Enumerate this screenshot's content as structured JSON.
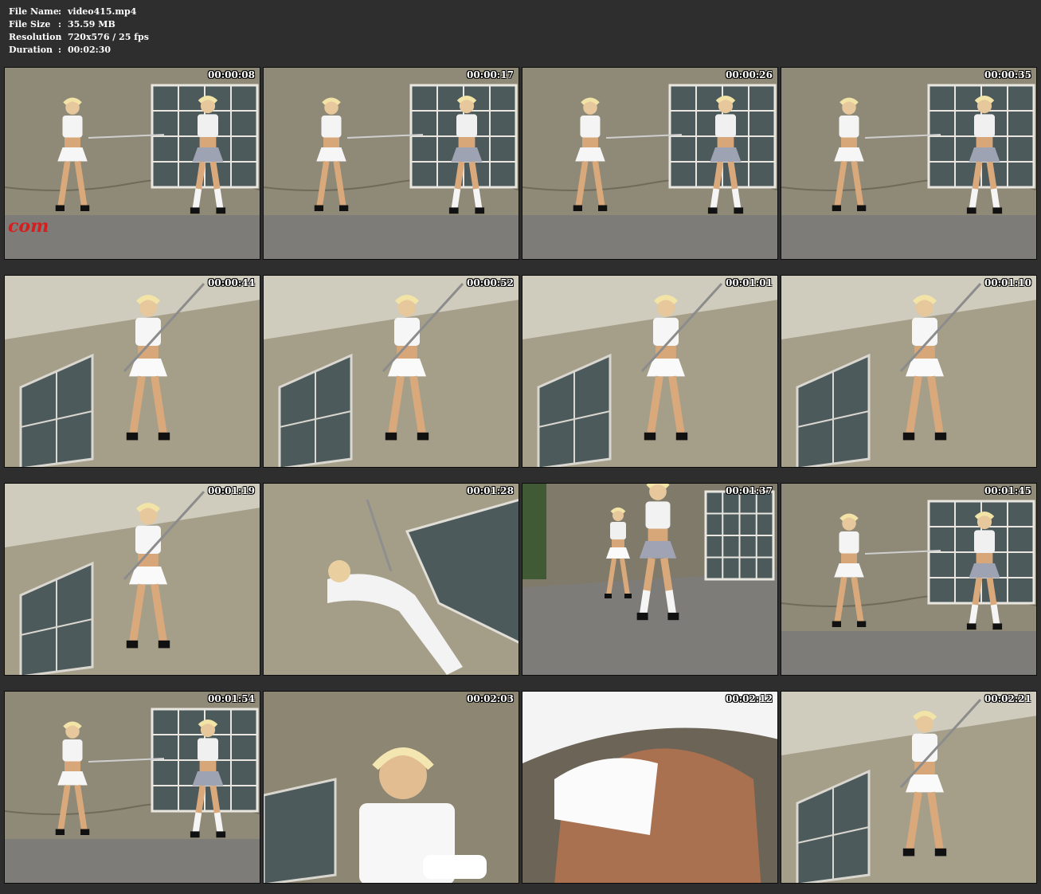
{
  "info": [
    {
      "key": "File Name",
      "sep": ":",
      "value": "video415.mp4"
    },
    {
      "key": "File Size",
      "sep": ":",
      "value": "35.59 MB"
    },
    {
      "key": "Resolution",
      "sep": ":",
      "value": "720x576 / 25 fps"
    },
    {
      "key": "Duration",
      "sep": ":",
      "value": "00:02:30"
    }
  ],
  "thumbnails": [
    {
      "timestamp": "00:00:08",
      "scene": "wide-window"
    },
    {
      "timestamp": "00:00:17",
      "scene": "wide-window"
    },
    {
      "timestamp": "00:00:26",
      "scene": "wide-window"
    },
    {
      "timestamp": "00:00:35",
      "scene": "wide-window"
    },
    {
      "timestamp": "00:00:44",
      "scene": "lowangle"
    },
    {
      "timestamp": "00:00:52",
      "scene": "lowangle"
    },
    {
      "timestamp": "00:01:01",
      "scene": "lowangle"
    },
    {
      "timestamp": "00:01:10",
      "scene": "lowangle"
    },
    {
      "timestamp": "00:01:19",
      "scene": "lowangle"
    },
    {
      "timestamp": "00:01:28",
      "scene": "tilted"
    },
    {
      "timestamp": "00:01:37",
      "scene": "walkway"
    },
    {
      "timestamp": "00:01:45",
      "scene": "wide-window"
    },
    {
      "timestamp": "00:01:54",
      "scene": "wide-window"
    },
    {
      "timestamp": "00:02:03",
      "scene": "closeup"
    },
    {
      "timestamp": "00:02:12",
      "scene": "skirt"
    },
    {
      "timestamp": "00:02:21",
      "scene": "lowangle"
    }
  ],
  "watermark": "com",
  "colors": {
    "background": "#2e2e2e",
    "wall": "#8f8a77",
    "ground": "#7e7c78",
    "window": "#4d5a5c",
    "watermark": "#d51f1f"
  }
}
